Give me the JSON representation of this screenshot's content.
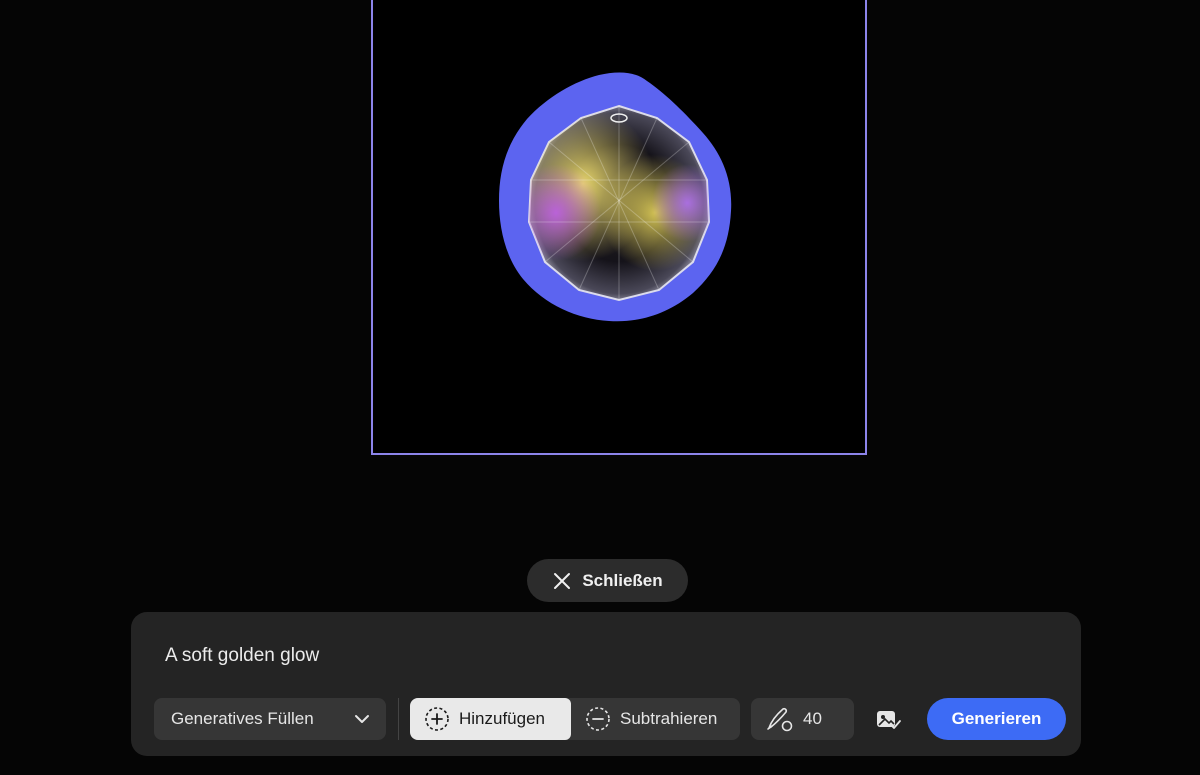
{
  "canvas": {
    "selection_color": "#5c64f0",
    "artboard_border_color": "#8c84ea"
  },
  "close_button": {
    "label": "Schließen",
    "icon": "close-icon"
  },
  "prompt_panel": {
    "prompt_text": "A soft golden glow",
    "mode_select": {
      "label": "Generatives Füllen",
      "icon": "chevron-down-icon"
    },
    "selection_modes": [
      {
        "label": "Hinzufügen",
        "icon": "add-selection-icon",
        "active": true
      },
      {
        "label": "Subtrahieren",
        "icon": "subtract-selection-icon",
        "active": false
      }
    ],
    "brush": {
      "icon": "brush-icon",
      "size": "40"
    },
    "reference_image_icon": "reference-image-icon",
    "generate_button": {
      "label": "Generieren",
      "color": "#3d6bf5"
    }
  }
}
